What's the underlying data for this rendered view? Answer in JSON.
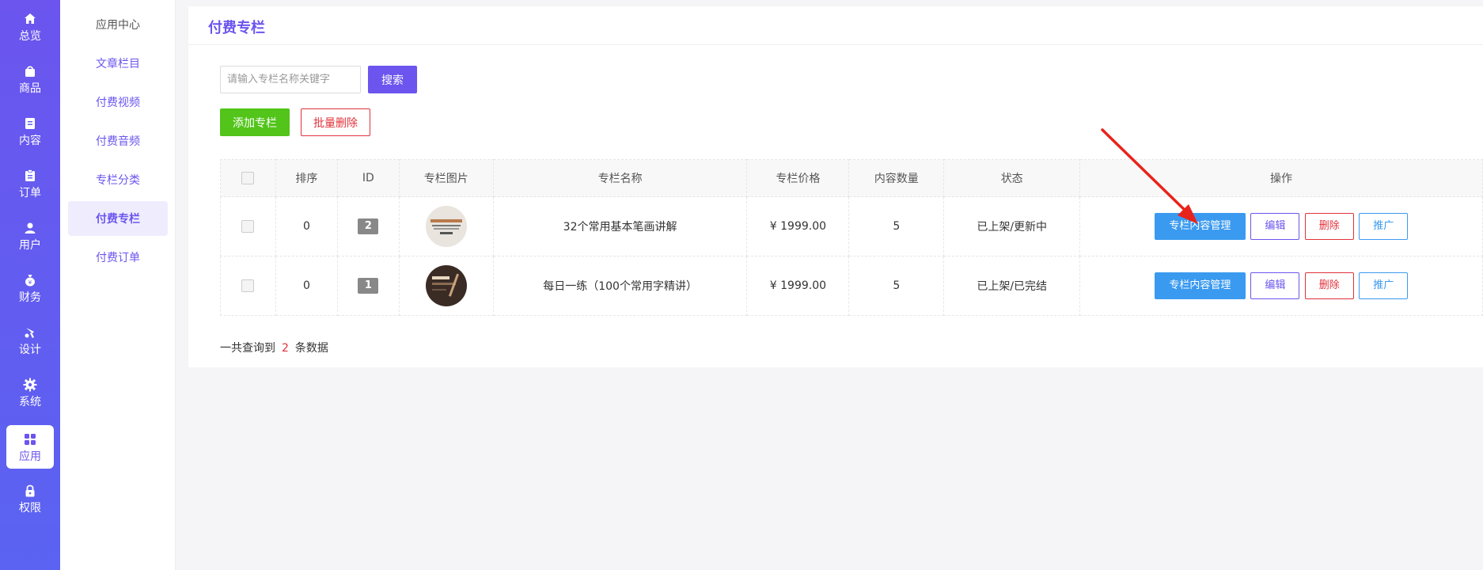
{
  "sidebar": {
    "items": [
      {
        "label": "总览",
        "icon": "home-icon"
      },
      {
        "label": "商品",
        "icon": "bag-icon"
      },
      {
        "label": "内容",
        "icon": "document-icon"
      },
      {
        "label": "订单",
        "icon": "clipboard-icon"
      },
      {
        "label": "用户",
        "icon": "user-icon"
      },
      {
        "label": "财务",
        "icon": "money-bag-icon"
      },
      {
        "label": "设计",
        "icon": "brush-icon"
      },
      {
        "label": "系统",
        "icon": "gear-icon"
      },
      {
        "label": "应用",
        "icon": "grid-icon",
        "active": true
      },
      {
        "label": "权限",
        "icon": "lock-icon"
      }
    ]
  },
  "submenu": {
    "items": [
      {
        "label": "应用中心"
      },
      {
        "label": "文章栏目"
      },
      {
        "label": "付费视频"
      },
      {
        "label": "付费音频"
      },
      {
        "label": "专栏分类"
      },
      {
        "label": "付费专栏",
        "active": true
      },
      {
        "label": "付费订单"
      }
    ]
  },
  "page": {
    "title": "付费专栏"
  },
  "search": {
    "placeholder": "请输入专栏名称关键字",
    "button": "搜索"
  },
  "actions": {
    "add": "添加专栏",
    "batch_delete": "批量删除"
  },
  "table": {
    "headers": [
      "排序",
      "ID",
      "专栏图片",
      "专栏名称",
      "专栏价格",
      "内容数量",
      "状态",
      "操作"
    ],
    "rows": [
      {
        "sort": "0",
        "id": "2",
        "name": "32个常用基本笔画讲解",
        "price": "¥ 1999.00",
        "count": "5",
        "status": "已上架/更新中"
      },
      {
        "sort": "0",
        "id": "1",
        "name": "每日一练（100个常用字精讲）",
        "price": "¥ 1999.00",
        "count": "5",
        "status": "已上架/已完结"
      }
    ],
    "row_actions": {
      "manage": "专栏内容管理",
      "edit": "编辑",
      "delete": "删除",
      "promote": "推广"
    }
  },
  "summary": {
    "prefix": "一共查询到",
    "count": "2",
    "suffix": "条数据"
  },
  "colors": {
    "primary": "#6b55ee",
    "success": "#52c41a",
    "danger": "#e0323b",
    "info": "#3a9af0",
    "annotation": "#e8231b"
  }
}
